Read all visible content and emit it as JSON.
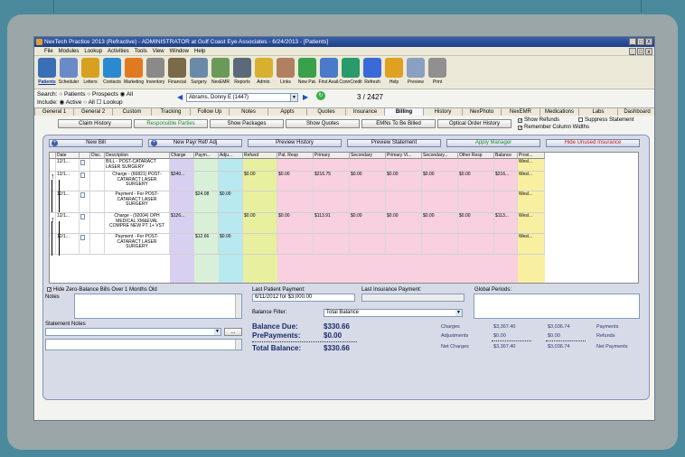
{
  "window": {
    "title": "NexTech Practice 2013 (Refractive) - ADMINISTRATOR at Gulf Coast Eye Associates - 6/24/2013 - [Patients]",
    "controls": [
      "_",
      "̲",
      "X"
    ]
  },
  "menu": [
    "File",
    "Modules",
    "Lookup",
    "Activities",
    "Tools",
    "View",
    "Window",
    "Help"
  ],
  "toolbar": [
    {
      "label": "Patients",
      "icon": "patients-icon",
      "color": "#3a6fb8"
    },
    {
      "label": "Scheduler",
      "icon": "calendar-icon",
      "color": "#6a8ac8"
    },
    {
      "label": "Letters",
      "icon": "pencil-icon",
      "color": "#d8a020"
    },
    {
      "label": "Contacts",
      "icon": "contacts-icon",
      "color": "#2a8ad0"
    },
    {
      "label": "Marketing",
      "icon": "pie-chart-icon",
      "color": "#e07a20"
    },
    {
      "label": "Inventory",
      "icon": "box-icon",
      "color": "#8a8a8a"
    },
    {
      "label": "Financial",
      "icon": "safe-icon",
      "color": "#7a6a4a"
    },
    {
      "label": "Surgery",
      "icon": "surgery-icon",
      "color": "#6a8aaa"
    },
    {
      "label": "NexEMR",
      "icon": "clipboard-icon",
      "color": "#6a9a5a"
    },
    {
      "label": "Reports",
      "icon": "printer-icon",
      "color": "#5a6a7a"
    },
    {
      "label": "Admin.",
      "icon": "key-icon",
      "color": "#d8b030"
    },
    {
      "label": "Links",
      "icon": "handshake-icon",
      "color": "#b08060"
    },
    {
      "label": "New Pat.",
      "icon": "new-patient-icon",
      "color": "#3aa04a"
    },
    {
      "label": "First Avail.",
      "icon": "first-available-icon",
      "color": "#4a7ac8"
    },
    {
      "label": "ConnCredit",
      "icon": "conncredit-icon",
      "color": "#2a9a6a"
    },
    {
      "label": "Refresh",
      "icon": "refresh-icon",
      "color": "#3a6ad8"
    },
    {
      "label": "Help",
      "icon": "help-icon",
      "color": "#e0a020"
    },
    {
      "label": "Preview",
      "icon": "preview-icon",
      "color": "#8aa0c0"
    },
    {
      "label": "Print",
      "icon": "print-icon",
      "color": "#909090"
    }
  ],
  "search": {
    "label": "Search:",
    "options": [
      "Patients",
      "Prospects",
      "All"
    ],
    "include_label": "Include:",
    "include": [
      "Active",
      "All",
      "Lookup"
    ],
    "patient": "Abrams, Donny E (1447)",
    "count": "3 / 2427"
  },
  "tabs": [
    "General 1",
    "General 2",
    "Custom",
    "Tracking",
    "Follow Up",
    "Notes",
    "Appts",
    "Quotes",
    "Insurance",
    "Billing",
    "History",
    "NexPhoto",
    "NexEMR",
    "Medications",
    "Labs",
    "Dashboard"
  ],
  "active_tab": "Billing",
  "subbuttons": [
    "Claim History",
    "Responsible Parties",
    "Show Packages",
    "Show Quotes",
    "EMNs To Be Billed",
    "Optical Order History"
  ],
  "checks": {
    "show_refunds": "Show Refunds",
    "remember_widths": "Remember Column Widths",
    "suppress": "Suppress Statement"
  },
  "actions": {
    "new_bill": "New Bill",
    "new_pay": "New Pay/ Ref/ Adj",
    "preview_history": "Preview History",
    "preview_statement": "Preview Statement",
    "apply_manager": "Apply Manager",
    "hide_insurance": "Hide Unused Insurance"
  },
  "grid": {
    "headers": [
      "",
      "Date",
      "",
      "Disc.",
      "Description",
      "Charge",
      "Paym...",
      "Adju...",
      "Refund",
      "Pat. Resp",
      "Primary",
      "Secondary",
      "Primary Vi...",
      "Secondary...",
      "Other Resp",
      "Balance",
      "Provi..."
    ],
    "rows": [
      [
        "",
        "12/1...",
        "",
        "",
        "BILL - POST-CATARACT LASER SURGERY",
        "",
        "",
        "",
        "",
        "",
        "",
        "",
        "",
        "",
        "",
        "",
        "Wesl..."
      ],
      [
        "",
        "12/1...",
        "",
        "",
        "Charge - (66821) POST-CATARACT LASER SURGERY",
        "$240...",
        "",
        "",
        "$0.00",
        "$0.00",
        "$216.75",
        "$0.00",
        "$0.00",
        "$0.00",
        "$0.00",
        "$216...",
        "Wesl..."
      ],
      [
        "",
        "12/1...",
        "",
        "",
        "Payment - For POST-CATARACT LASER SURGERY",
        "",
        "$24.08",
        "$0.00",
        "",
        "",
        "",
        "",
        "",
        "",
        "",
        "",
        "Wesl..."
      ],
      [
        "",
        "12/1...",
        "",
        "",
        "Charge - (92004) OPH MEDICAL XM&EVAL COMPRE NEW PT 1+ VST",
        "$126...",
        "",
        "",
        "$0.00",
        "$0.00",
        "$113.91",
        "$0.00",
        "$0.00",
        "$0.00",
        "$0.00",
        "$113...",
        "Wesl..."
      ],
      [
        "",
        "12/1...",
        "",
        "",
        "Payment - For POST-CATARACT LASER SURGERY",
        "",
        "$12.66",
        "$0.00",
        "",
        "",
        "",
        "",
        "",
        "",
        "",
        "",
        "Wesl..."
      ]
    ]
  },
  "bottom": {
    "hide_zero": "Hide Zero-Balance Bills Over 1 Months Old",
    "notes_label": "Notes",
    "statement_notes_label": "Statement Notes",
    "ellipsis": "...",
    "last_patient_payment_label": "Last Patient Payment:",
    "last_patient_payment": "6/11/2012 for $3,000.00",
    "last_insurance_payment_label": "Last Insurance Payment:",
    "global_periods_label": "Global Periods:",
    "balance_filter_label": "Balance Filter:",
    "balance_filter": "Total Balance",
    "balance_due_label": "Balance Due:",
    "balance_due": "$330.66",
    "prepayments_label": "PrePayments:",
    "prepayments": "$0.00",
    "total_balance_label": "Total Balance:",
    "total_balance": "$330.66",
    "charges_label": "Charges",
    "charges_a": "$3,367.40",
    "charges_b": "$3,036.74",
    "payments_label": "Payments",
    "adjustments_label": "Adjustments",
    "adjustments_a": "$0.00",
    "adjustments_b": "$0.00",
    "refunds_label": "Refunds",
    "net_charges_label": "Net Charges",
    "net_charges_a": "$3,367.40",
    "net_charges_b": "$3,036.74",
    "net_payments_label": "Net Payments"
  }
}
